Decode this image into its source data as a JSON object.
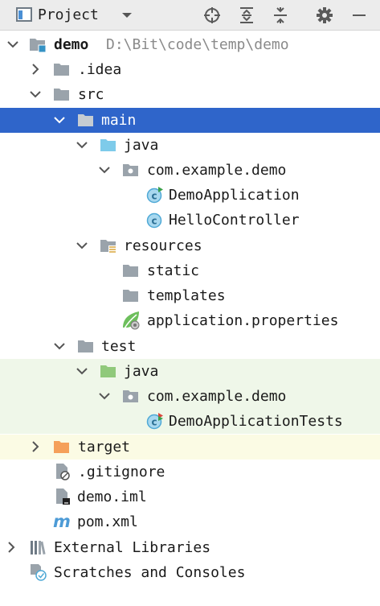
{
  "toolbar": {
    "title": "Project",
    "icons": [
      "locate-icon",
      "expand-all-icon",
      "collapse-all-icon",
      "gear-icon",
      "minimize-icon"
    ]
  },
  "tree": {
    "demo": {
      "label": "demo",
      "path": "D:\\Bit\\code\\temp\\demo"
    },
    "idea": {
      "label": ".idea"
    },
    "src": {
      "label": "src"
    },
    "main": {
      "label": "main"
    },
    "main_java": {
      "label": "java"
    },
    "main_pkg": {
      "label": "com.example.demo"
    },
    "demo_app": {
      "label": "DemoApplication"
    },
    "hello_ctrl": {
      "label": "HelloController"
    },
    "resources": {
      "label": "resources"
    },
    "static": {
      "label": "static"
    },
    "templates": {
      "label": "templates"
    },
    "app_props": {
      "label": "application.properties"
    },
    "test": {
      "label": "test"
    },
    "test_java": {
      "label": "java"
    },
    "test_pkg": {
      "label": "com.example.demo"
    },
    "demo_tests": {
      "label": "DemoApplicationTests"
    },
    "target": {
      "label": "target"
    },
    "gitignore": {
      "label": ".gitignore"
    },
    "demo_iml": {
      "label": "demo.iml"
    },
    "pom": {
      "label": "pom.xml"
    },
    "ext_libs": {
      "label": "External Libraries"
    },
    "scratches": {
      "label": "Scratches and Consoles"
    }
  },
  "colors": {
    "selection": "#2f65ca",
    "folder_gray": "#9aa3ab",
    "source_blue": "#7ecbea",
    "test_green": "#90c97b",
    "excluded_orange": "#f5a05a",
    "class_teal": "#4fa9d6",
    "test_row_bg": "#eff7e9",
    "excluded_row_bg": "#fbfbe4"
  }
}
